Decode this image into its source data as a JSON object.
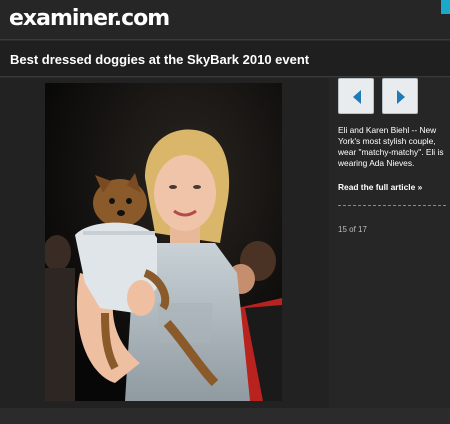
{
  "header": {
    "logo_text": "examiner.com",
    "accent_color": "#1aa9c8"
  },
  "slideshow": {
    "title": "Best dressed doggies at the SkyBark 2010 event",
    "photo_alt": "Eli and Karen Biehl",
    "caption": "Eli and Karen Biehl -- New York's most stylish couple, wear \"matchy-matchy\". Eli is wearing Ada Nieves.",
    "read_more_label": "Read the full article »",
    "counter": "15 of 17",
    "prev_icon": "chevron-left-icon",
    "next_icon": "chevron-right-icon",
    "button_icon_color": "#1e7bb8"
  }
}
